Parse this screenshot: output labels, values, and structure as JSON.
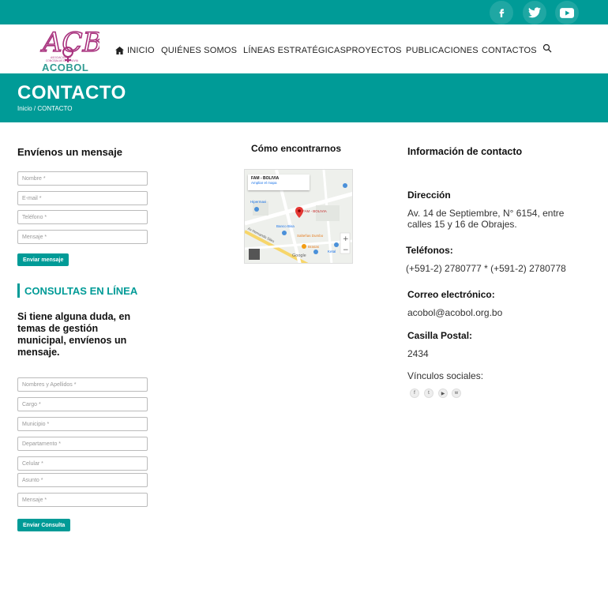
{
  "topbar": {
    "social": [
      {
        "name": "facebook",
        "glyph": "f"
      },
      {
        "name": "twitter",
        "glyph": "🐦"
      },
      {
        "name": "youtube",
        "glyph": "▶"
      }
    ]
  },
  "logo": {
    "text": "ACOBOL",
    "monogram": "ACB",
    "tagline": "ASOCIACIÓN DE CONCEJALAS DE BOLIVIA"
  },
  "nav": {
    "home": "INICIO",
    "about": "QUIÉNES SOMOS",
    "lines": "LÍNEAS ESTRATÉGICAS",
    "projects": "PROYECTOS",
    "publications": "PUBLICACIONES",
    "contacts": "CONTACTOS"
  },
  "hero": {
    "title": "CONTACTO",
    "breadcrumb": "Inicio / CONTACTO"
  },
  "message_form": {
    "title": "Envíenos un mensaje",
    "name_placeholder": "Nombre *",
    "email_placeholder": "E-mail *",
    "phone_placeholder": "Teléfono *",
    "message_placeholder": "Mensaje *",
    "submit": "Enviar mensaje"
  },
  "consultas": {
    "title": "CONSULTAS EN LÍNEA",
    "lead": "Si tiene alguna duda, en temas de gestión municipal, envíenos un mensaje.",
    "fields": {
      "fullname": "Nombres y Apellidos *",
      "cargo": "Cargo *",
      "municipio": "Municipio *",
      "departamento": "Departamento *",
      "celular": "Celular *",
      "asunto": "Asunto *",
      "mensaje": "Mensaje *"
    },
    "submit": "Enviar Consulta"
  },
  "map": {
    "title": "Cómo encontrarnos",
    "place": "FAM - BOLIVIA",
    "enlarge": "Ampliar el mapa",
    "marker_label": "FAM - BOLIVIA",
    "labels": {
      "hipermaxi": "Hipermaxi",
      "banco": "Banco Bisa",
      "saltenas": "Salteñas Dumbo",
      "brasas": "Brasas",
      "ketal": "Ketal",
      "street": "Av Hernando Siles",
      "google": "Google"
    }
  },
  "contact_info": {
    "title": "Información de contacto",
    "address_label": "Dirección",
    "address_line1": "Av. 14 de Septiembre, N° 6154, entre",
    "address_line2": "calles 15 y 16 de Obrajes.",
    "phones_label": "Teléfonos:",
    "phones": "(+591-2) 2780777 * (+591-2) 2780778",
    "email_label": "Correo electrónico:",
    "email": "acobol@acobol.org.bo",
    "po_label": "Casilla Postal:",
    "po": "2434",
    "social_label": "Vínculos sociales:",
    "social": [
      "f",
      "t",
      "▶",
      "w"
    ]
  },
  "colors": {
    "accent": "#009b97",
    "logo_purple": "#a8327e"
  }
}
